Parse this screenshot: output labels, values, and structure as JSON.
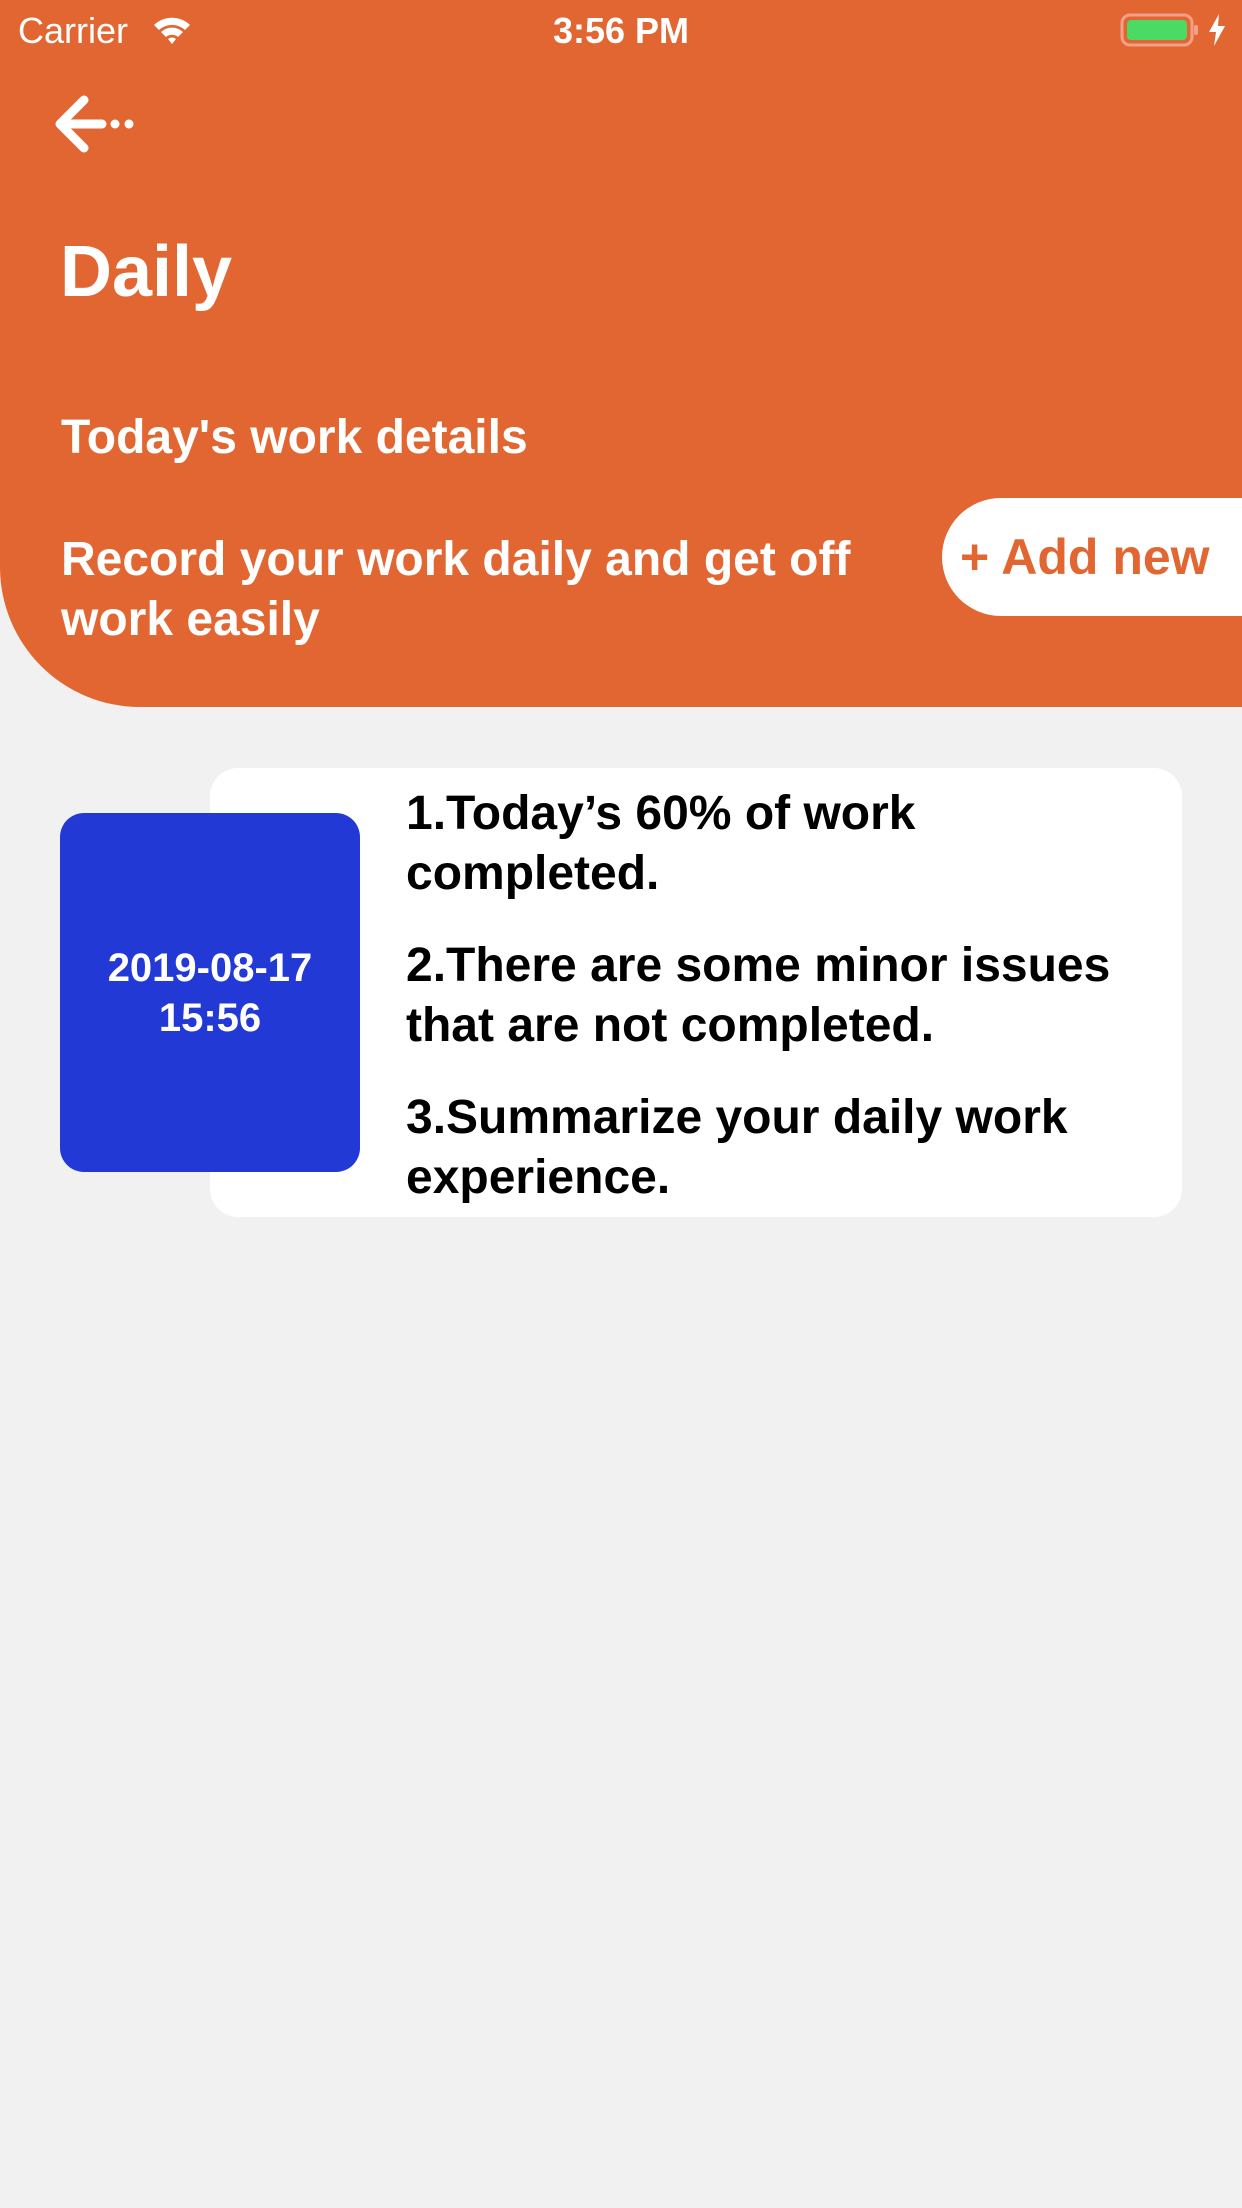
{
  "status_bar": {
    "carrier": "Carrier",
    "time": "3:56 PM"
  },
  "header": {
    "title": "Daily",
    "subtitle": "Today's work details",
    "description": "Record your work daily and get off work easily",
    "add_button_label": "+ Add new"
  },
  "entries": [
    {
      "date": "2019-08-17",
      "time": "15:56",
      "items": [
        "1.Today’s 60% of work completed.",
        "2.There are some minor issues that are not completed.",
        "3.Summarize your daily work experience."
      ]
    }
  ],
  "colors": {
    "header": "#e26632",
    "date_block": "#2339d6",
    "background": "#f1f1f1"
  },
  "icons": {
    "back": "back-arrow-icon",
    "wifi": "wifi-icon",
    "battery": "battery-icon",
    "charge": "charging-bolt-icon"
  }
}
